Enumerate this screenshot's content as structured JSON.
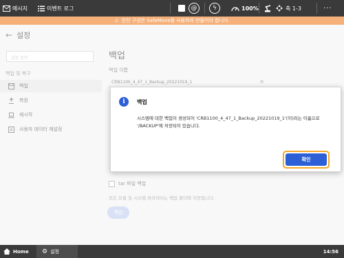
{
  "topbar": {
    "messages_label": "메시지",
    "event_log_label": "이벤트 로그",
    "speed": "100%",
    "axis_label": "축 1-3",
    "more": "···"
  },
  "banner": {
    "text": "안전 구성은 SafeMove를 사용하여 만들어야 합니다."
  },
  "header": {
    "title": "설정"
  },
  "left": {
    "search_placeholder": "설정 검색",
    "section": "백업 및 복구",
    "items": [
      {
        "label": "백업",
        "icon": "save-icon"
      },
      {
        "label": "복원",
        "icon": "restore-icon"
      },
      {
        "label": "재시작",
        "icon": "laptop-icon"
      },
      {
        "label": "사용자 데이터 재설정",
        "icon": "reset-icon"
      }
    ]
  },
  "main": {
    "title": "백업",
    "field_label": "백업 이름",
    "field_value": "CRB1100_4_47_1_Backup_20221019_1",
    "checkbox_label": "tar 파일 백업",
    "help_text": "모든 모듈 및 시스템 파라미터는 백업 폴더에 저장됩니다.",
    "button": "백업"
  },
  "dialog": {
    "title": "백업",
    "message": "시스템에 대한 백업이 생성되어 'CRB1100_4_47_1_Backup_20221019_1'(이)라는 이름으로 '/BACKUP'에 저장되어 있습니다.",
    "ok": "확인"
  },
  "bottombar": {
    "home": "Home",
    "settings": "설정",
    "time": "14:56"
  },
  "colors": {
    "topbar": "#3a3a3a",
    "banner": "#f5b07a",
    "accent": "#2d5fd6",
    "highlight": "#f5a623"
  }
}
